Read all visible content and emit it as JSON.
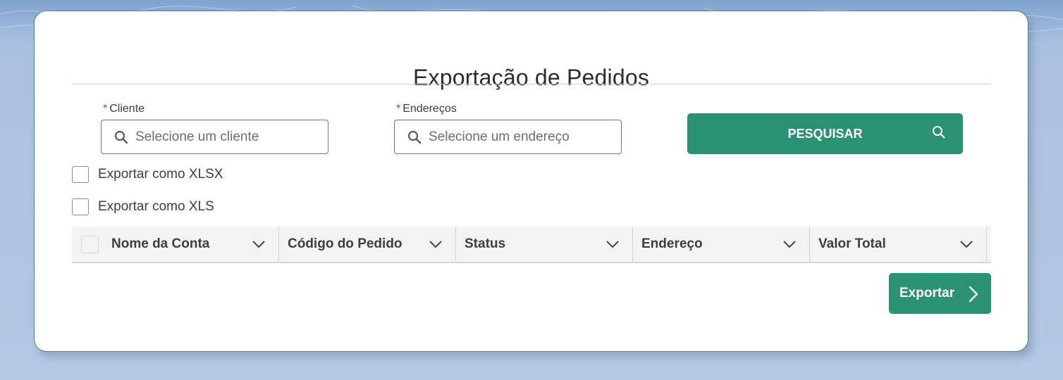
{
  "page": {
    "title": "Exportação de Pedidos"
  },
  "form": {
    "cliente": {
      "label": "Cliente",
      "required_mark": "*",
      "placeholder": "Selecione um cliente",
      "value": ""
    },
    "enderecos": {
      "label": "Endereços",
      "required_mark": "*",
      "placeholder": "Selecione um endereço",
      "value": ""
    },
    "search_button": {
      "label": "PESQUISAR",
      "icon": "search-icon"
    },
    "options": [
      {
        "label": "Exportar como XLSX",
        "checked": false
      },
      {
        "label": "Exportar como XLS",
        "checked": false
      }
    ]
  },
  "table": {
    "columns": [
      {
        "label": "Nome da Conta"
      },
      {
        "label": "Código do Pedido"
      },
      {
        "label": "Status"
      },
      {
        "label": "Endereço"
      },
      {
        "label": "Valor Total"
      }
    ],
    "rows": []
  },
  "export_button": {
    "label": "Exportar",
    "icon": "chevron-right-icon"
  },
  "colors": {
    "accent": "#2a9273",
    "required": "#c23934",
    "card_border": "#3b8f8a"
  }
}
